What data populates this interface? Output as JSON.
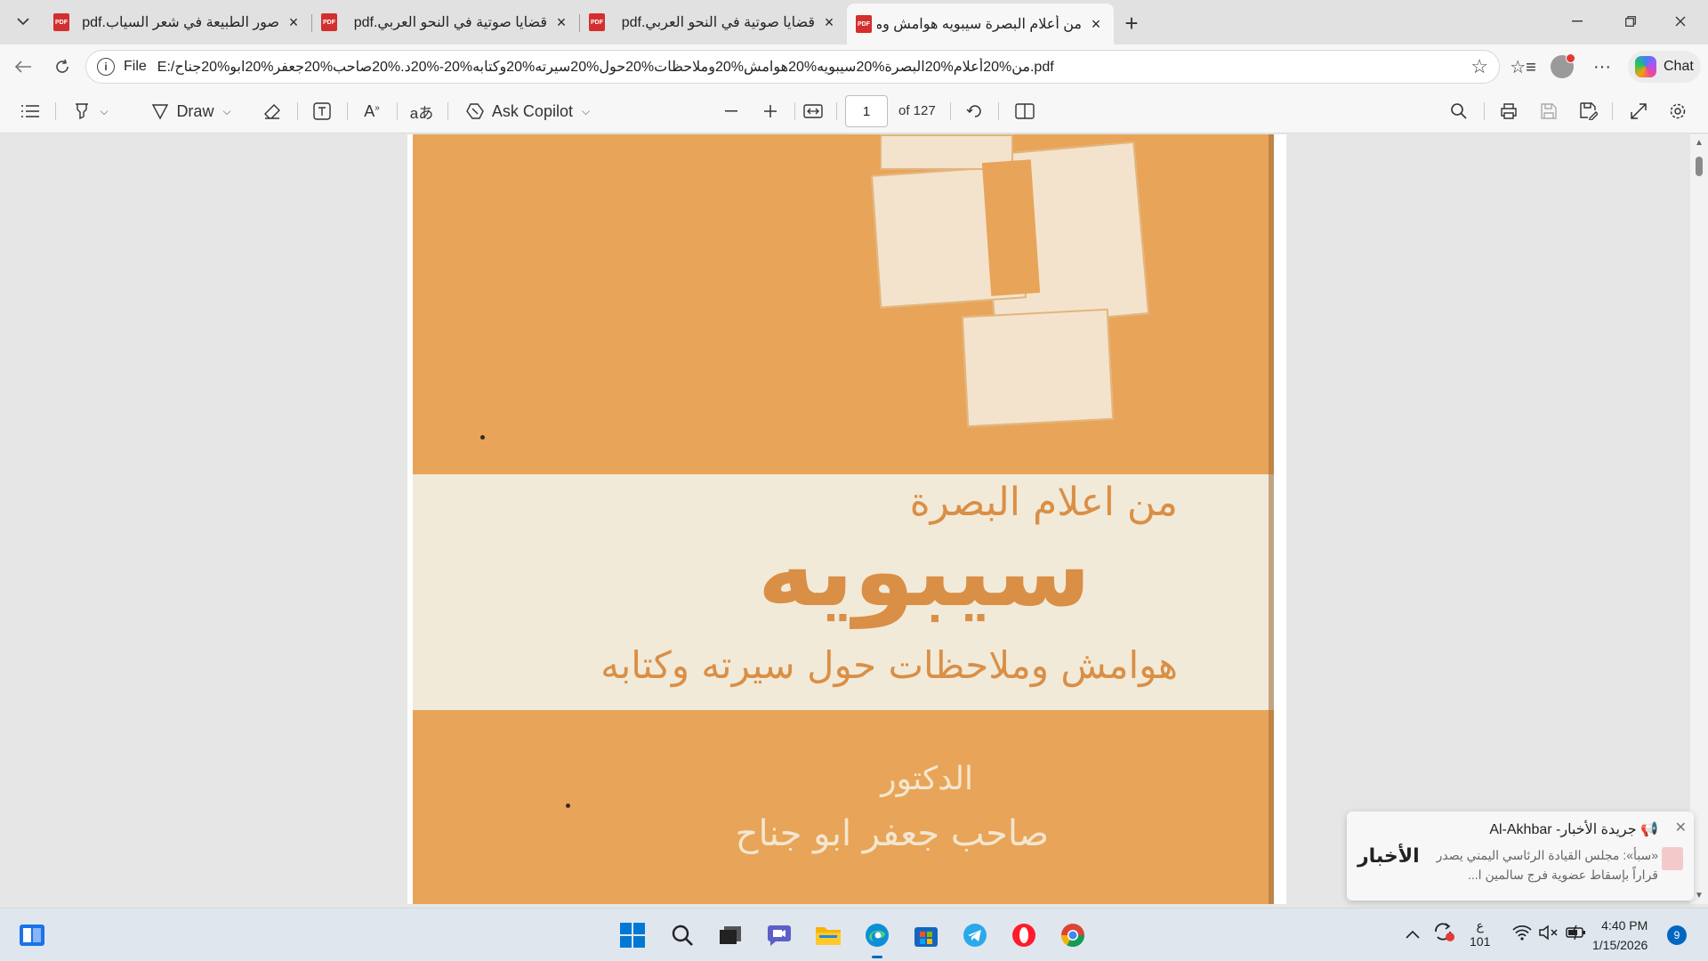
{
  "tabs": [
    {
      "title": "صور الطبيعة في شعر السياب.pdf",
      "active": false
    },
    {
      "title": "قضايا صوتية في النحو العربي.pdf",
      "active": false
    },
    {
      "title": "قضايا صوتية في النحو العربي.pdf",
      "active": false
    },
    {
      "title": "من أعلام البصرة سيبويه هوامش وملا",
      "active": true
    }
  ],
  "tab_icon_text": "PDF",
  "address": {
    "scheme": "File",
    "url": "E:/من%20أعلام%20البصرة%20سيبويه%20هوامش%20وملاحظات%20حول%20سيرته%20وكتابه%20-%20د.%20صاحب%20جعفر%20ابو%20جناح.pdf"
  },
  "chat_label": "Chat",
  "pdf_toolbar": {
    "draw_label": "Draw",
    "copilot_label": "Ask Copilot",
    "page_current": "1",
    "page_total": "of 127"
  },
  "cover": {
    "pretitle": "من اعلام البصرة",
    "title": "سيبويه",
    "subtitle": "هوامش وملاحظات حول سيرته وكتابه",
    "author_prefix": "الدكتور",
    "author": "صاحب جعفر ابو جناح"
  },
  "notification": {
    "title": "جريدة الأخبار- Al-Akhbar",
    "body": "«سبأ»: مجلس القيادة الرئاسي اليمني يصدر قراراً بإسقاط عضوية فرج سالمين ا...",
    "logo_text": "الأخبار"
  },
  "system_tray": {
    "keyboard_lang": "ع",
    "keyboard_sub": "101",
    "time": "4:40 PM",
    "date": "1/15/2026",
    "notif_count": "9"
  },
  "colors": {
    "cover_orange": "#e8a458",
    "cover_band": "#f2ead9",
    "accent": "#0067c0"
  }
}
